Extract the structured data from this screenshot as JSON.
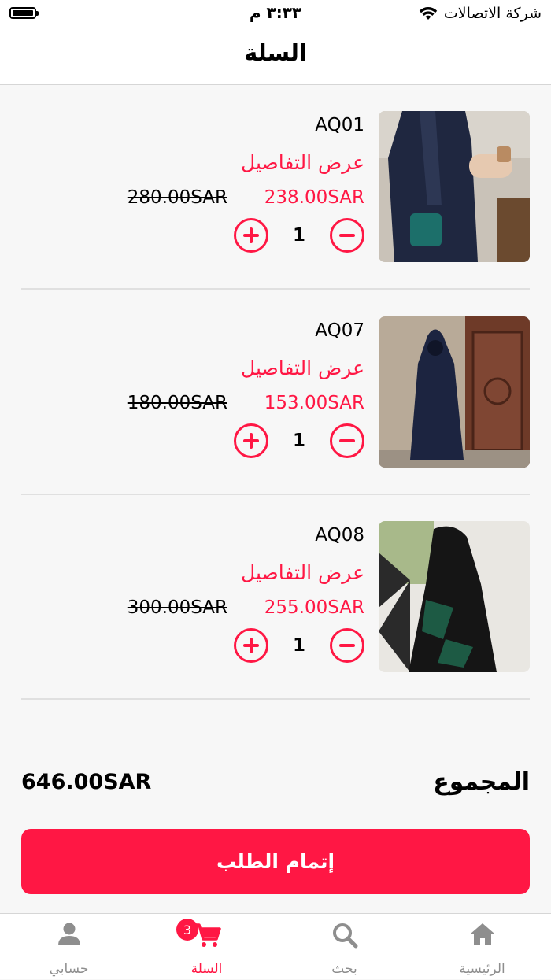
{
  "status_bar": {
    "carrier": "شركة الاتصالات",
    "time": "٣:٣٣ م"
  },
  "header": {
    "title": "السلة"
  },
  "cart_items": [
    {
      "code": "AQ01",
      "details_label": "عرض التفاصيل",
      "price": "238.00SAR",
      "old_price": "280.00SAR",
      "quantity": "1"
    },
    {
      "code": "AQ07",
      "details_label": "عرض التفاصيل",
      "price": "153.00SAR",
      "old_price": "180.00SAR",
      "quantity": "1"
    },
    {
      "code": "AQ08",
      "details_label": "عرض التفاصيل",
      "price": "255.00SAR",
      "old_price": "300.00SAR",
      "quantity": "1"
    }
  ],
  "summary": {
    "total_label": "المجموع",
    "total_value": "646.00SAR"
  },
  "checkout_label": "إتمام الطلب",
  "tab_bar": {
    "items": [
      {
        "label": "الرئيسية",
        "icon": "home-icon"
      },
      {
        "label": "بحث",
        "icon": "search-icon"
      },
      {
        "label": "السلة",
        "icon": "cart-icon",
        "active": true,
        "badge": "3"
      },
      {
        "label": "حسابي",
        "icon": "user-icon"
      }
    ]
  },
  "colors": {
    "accent": "#ff1744",
    "inactive": "#8e8e8e",
    "background": "#f7f7f7"
  }
}
